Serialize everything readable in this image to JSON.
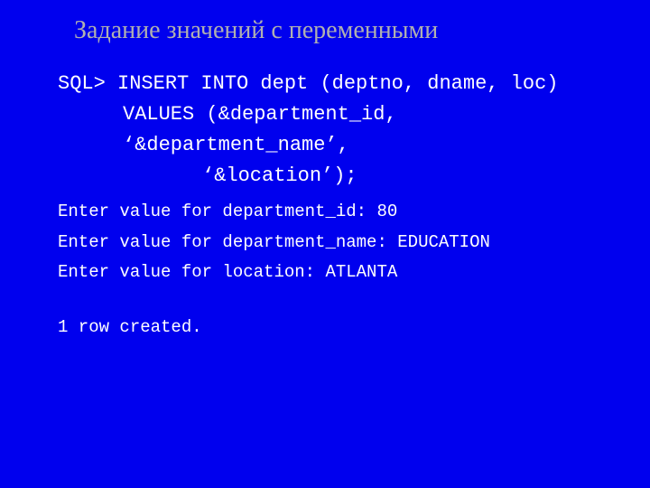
{
  "title": "Задание значений с переменными",
  "sql": {
    "l1": "SQL> INSERT INTO dept (deptno, dname, loc)",
    "l2": "VALUES (&department_id, ‘&department_name’,",
    "l3": "‘&location’);"
  },
  "prompts": {
    "p1": "Enter value for department_id: 80",
    "p2": "Enter value for department_name: EDUCATION",
    "p3": "Enter value for location: ATLANTA"
  },
  "result": "1 row created."
}
